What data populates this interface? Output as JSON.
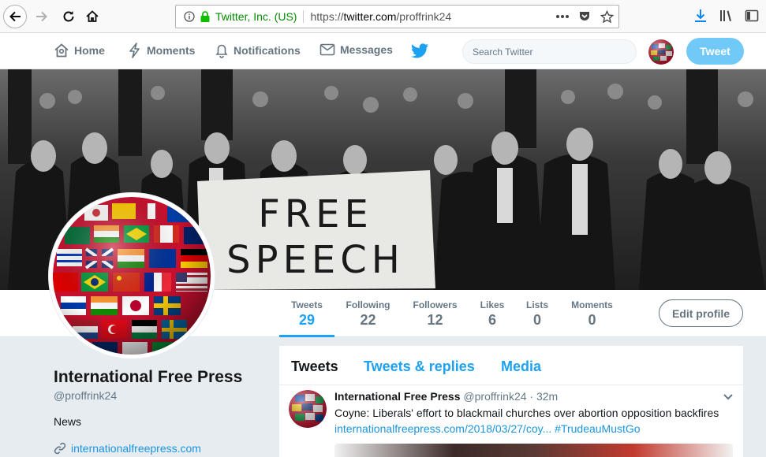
{
  "browser": {
    "site_identity": "Twitter, Inc. (US)",
    "url_prefix": "https://",
    "url_host": "twitter.com",
    "url_path": "/proffrink24"
  },
  "nav": {
    "home": "Home",
    "moments": "Moments",
    "notifications": "Notifications",
    "messages": "Messages",
    "search_placeholder": "Search Twitter",
    "tweet_button": "Tweet"
  },
  "banner": {
    "sign_line1": "FREE",
    "sign_line2": "SPEECH"
  },
  "stats": [
    {
      "label": "Tweets",
      "value": "29"
    },
    {
      "label": "Following",
      "value": "22"
    },
    {
      "label": "Followers",
      "value": "12"
    },
    {
      "label": "Likes",
      "value": "6"
    },
    {
      "label": "Lists",
      "value": "0"
    },
    {
      "label": "Moments",
      "value": "0"
    }
  ],
  "edit_profile": "Edit profile",
  "profile": {
    "name": "International Free Press",
    "handle": "@proffrink24",
    "bio": "News",
    "website": "internationalfreepress.com"
  },
  "tabs": {
    "tweets": "Tweets",
    "replies": "Tweets & replies",
    "media": "Media"
  },
  "tweet": {
    "name": "International Free Press",
    "handle": "@proffrink24",
    "time": "· 32m",
    "text": "Coyne: Liberals' effort to blackmail churches over abortion opposition backfires",
    "link": "internationalfreepress.com/2018/03/27/coy...",
    "hashtag": "#TrudeauMustGo"
  },
  "colors": {
    "brand_blue": "#1da1f2",
    "tweet_button_bg": "#71c9f8",
    "secure_green": "#058b00"
  }
}
